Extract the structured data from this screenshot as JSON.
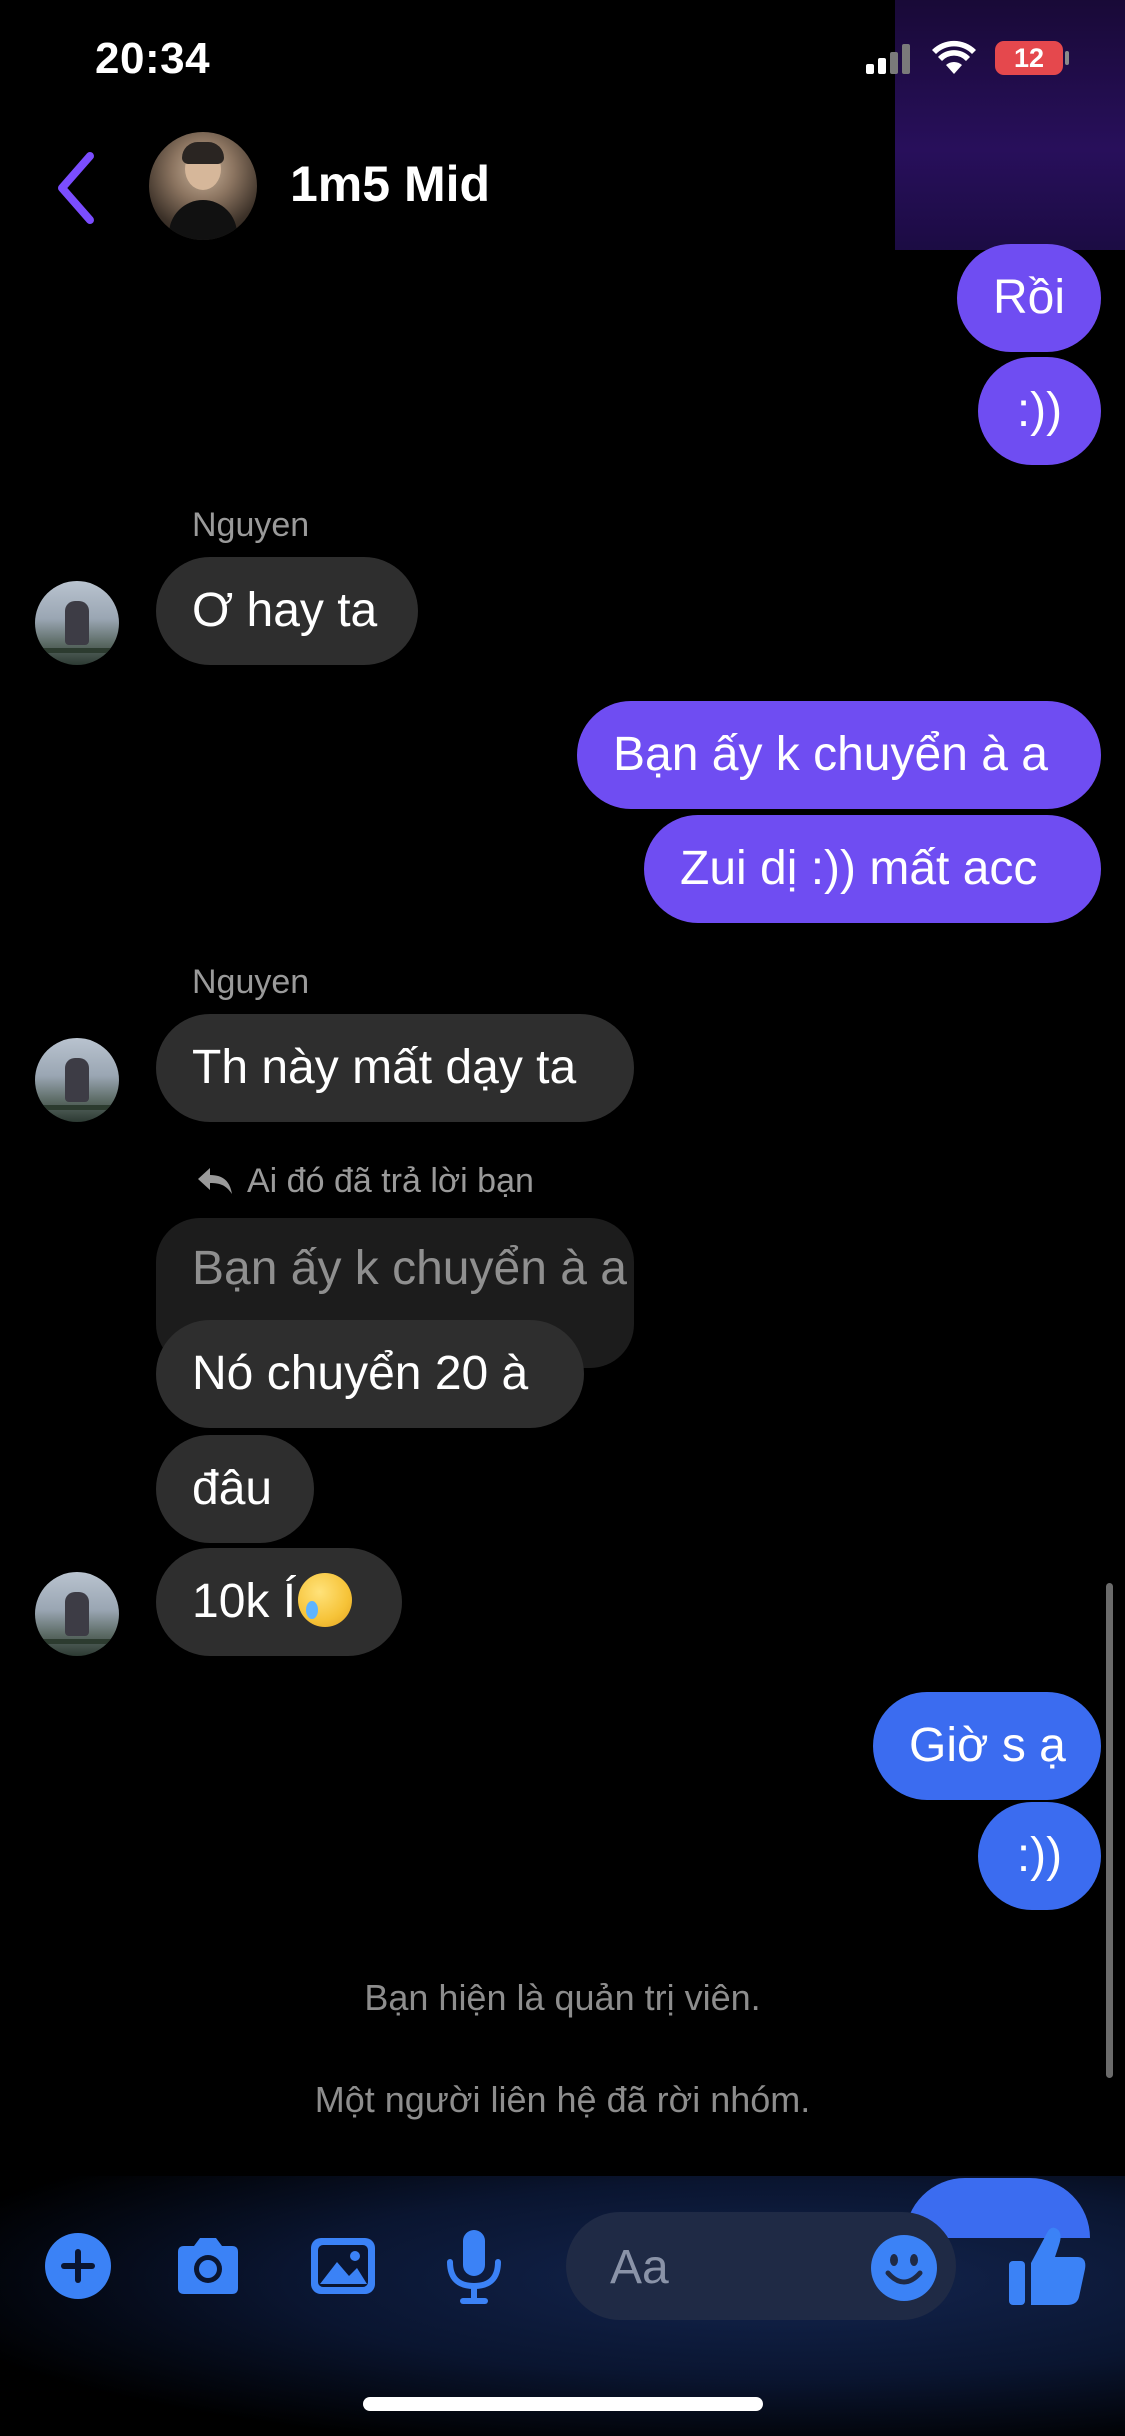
{
  "status_bar": {
    "time": "20:34",
    "battery": "12"
  },
  "header": {
    "title": "1m5 Mid"
  },
  "messages": {
    "m1": "Rồi",
    "m2": ":))",
    "sender1": "Nguyen",
    "m3": "Ơ hay ta",
    "m4": "Bạn ấy k chuyển à a",
    "m5": "Zui dị :)) mất acc",
    "sender2": "Nguyen",
    "m6": "Th này mất dạy ta",
    "reply_note": "Ai đó đã trả lời bạn",
    "quoted": "Bạn ấy k chuyển à a",
    "m7": "Nó chuyển 20 à",
    "m8": "đâu",
    "m9": "10k Í",
    "m10": "Giờ s ạ",
    "m11": ":))"
  },
  "system": {
    "s1": "Bạn hiện là quản trị viên.",
    "s2": "Một người liên hệ đã rời nhóm."
  },
  "composer": {
    "placeholder": "Aa"
  },
  "colors": {
    "outgoing": "#6f4df2",
    "outgoing_recent": "#3b6cf0",
    "incoming": "#2e2e2e",
    "accent": "#3b82f6"
  }
}
